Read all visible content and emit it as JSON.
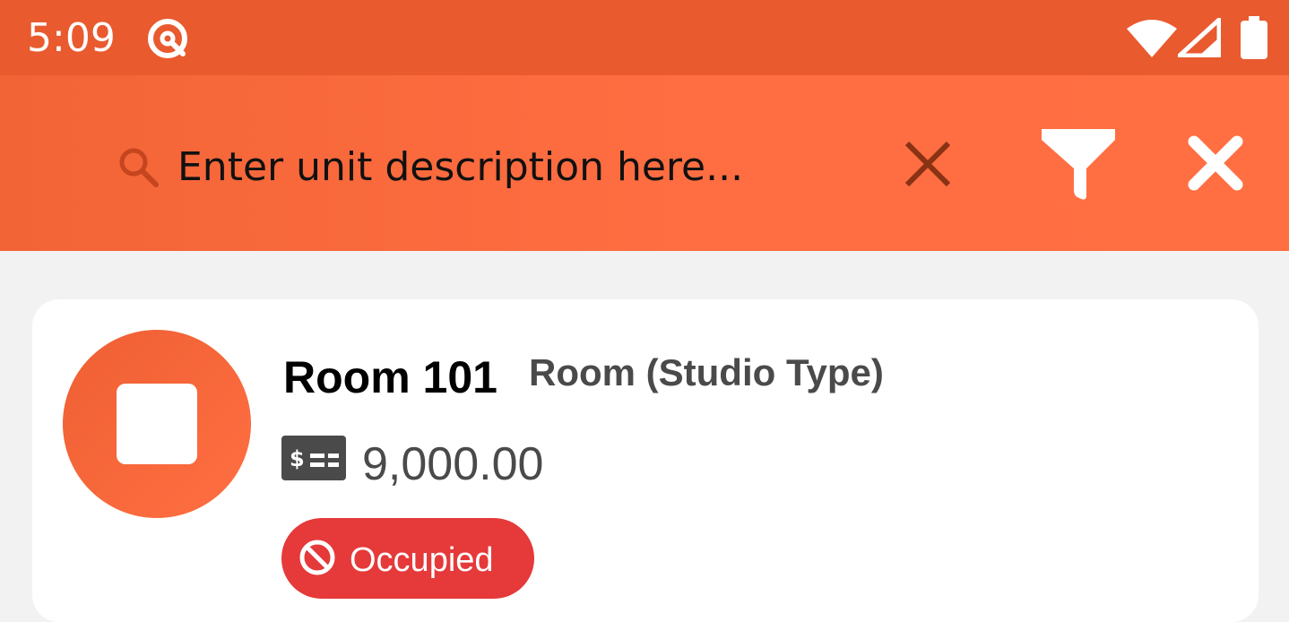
{
  "status_bar": {
    "time": "5:09",
    "app_icon": "app-notification-icon",
    "wifi_icon": "wifi-icon",
    "signal_icon": "signal-icon",
    "battery_icon": "battery-icon"
  },
  "search": {
    "placeholder": "Enter unit description here...",
    "value": "",
    "icon": "search-icon",
    "clear_icon": "clear-icon"
  },
  "actions": {
    "filter_icon": "filter-icon",
    "close_icon": "close-icon"
  },
  "units": [
    {
      "name": "Room 101",
      "type": "Room (Studio Type)",
      "price": "9,000.00",
      "status": "Occupied",
      "status_color": "#e5393a"
    }
  ],
  "colors": {
    "status_bar": "#e95a2f",
    "app_bar": "#ff6e42",
    "accent": "#ff6e42",
    "background": "#f2f2f2"
  }
}
